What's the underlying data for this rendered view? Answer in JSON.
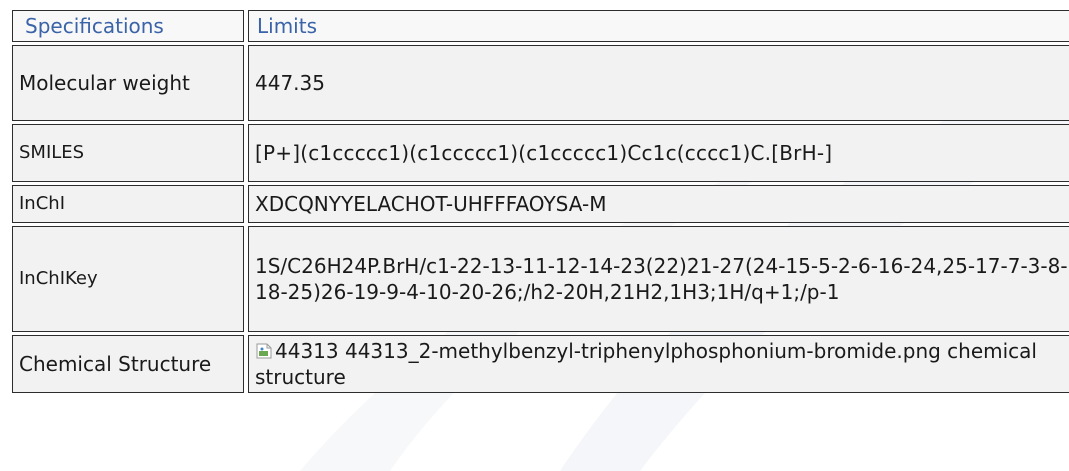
{
  "table": {
    "headers": {
      "spec": "Specifications",
      "limits": "Limits"
    },
    "rows": [
      {
        "label": "Molecular weight",
        "value": "447.35"
      },
      {
        "label": "SMILES",
        "value": "[P+](c1ccccc1)(c1ccccc1)(c1ccccc1)Cc1c(cccc1)C.[BrH-]"
      },
      {
        "label": "InChI",
        "value": "XDCQNYYELACHOT-UHFFFAOYSA-M"
      },
      {
        "label": "InChIKey",
        "value": "1S/C26H24P.BrH/c1-22-13-11-12-14-23(22)21-27(24-15-5-2-6-16-24,25-17-7-3-8-18-25)26-19-9-4-10-20-26;/h2-20H,21H2,1H3;1H/q+1;/p-1"
      },
      {
        "label": "Chemical Structure",
        "value": "44313 44313_2-methylbenzyl-triphenylphosphonium-bromide.png chemical structure"
      }
    ]
  },
  "icons": {
    "broken_image": "broken-image-icon"
  },
  "colors": {
    "header_text": "#3a63a8",
    "cell_bg": "#f2f2f2",
    "border": "#2d2d2d"
  }
}
